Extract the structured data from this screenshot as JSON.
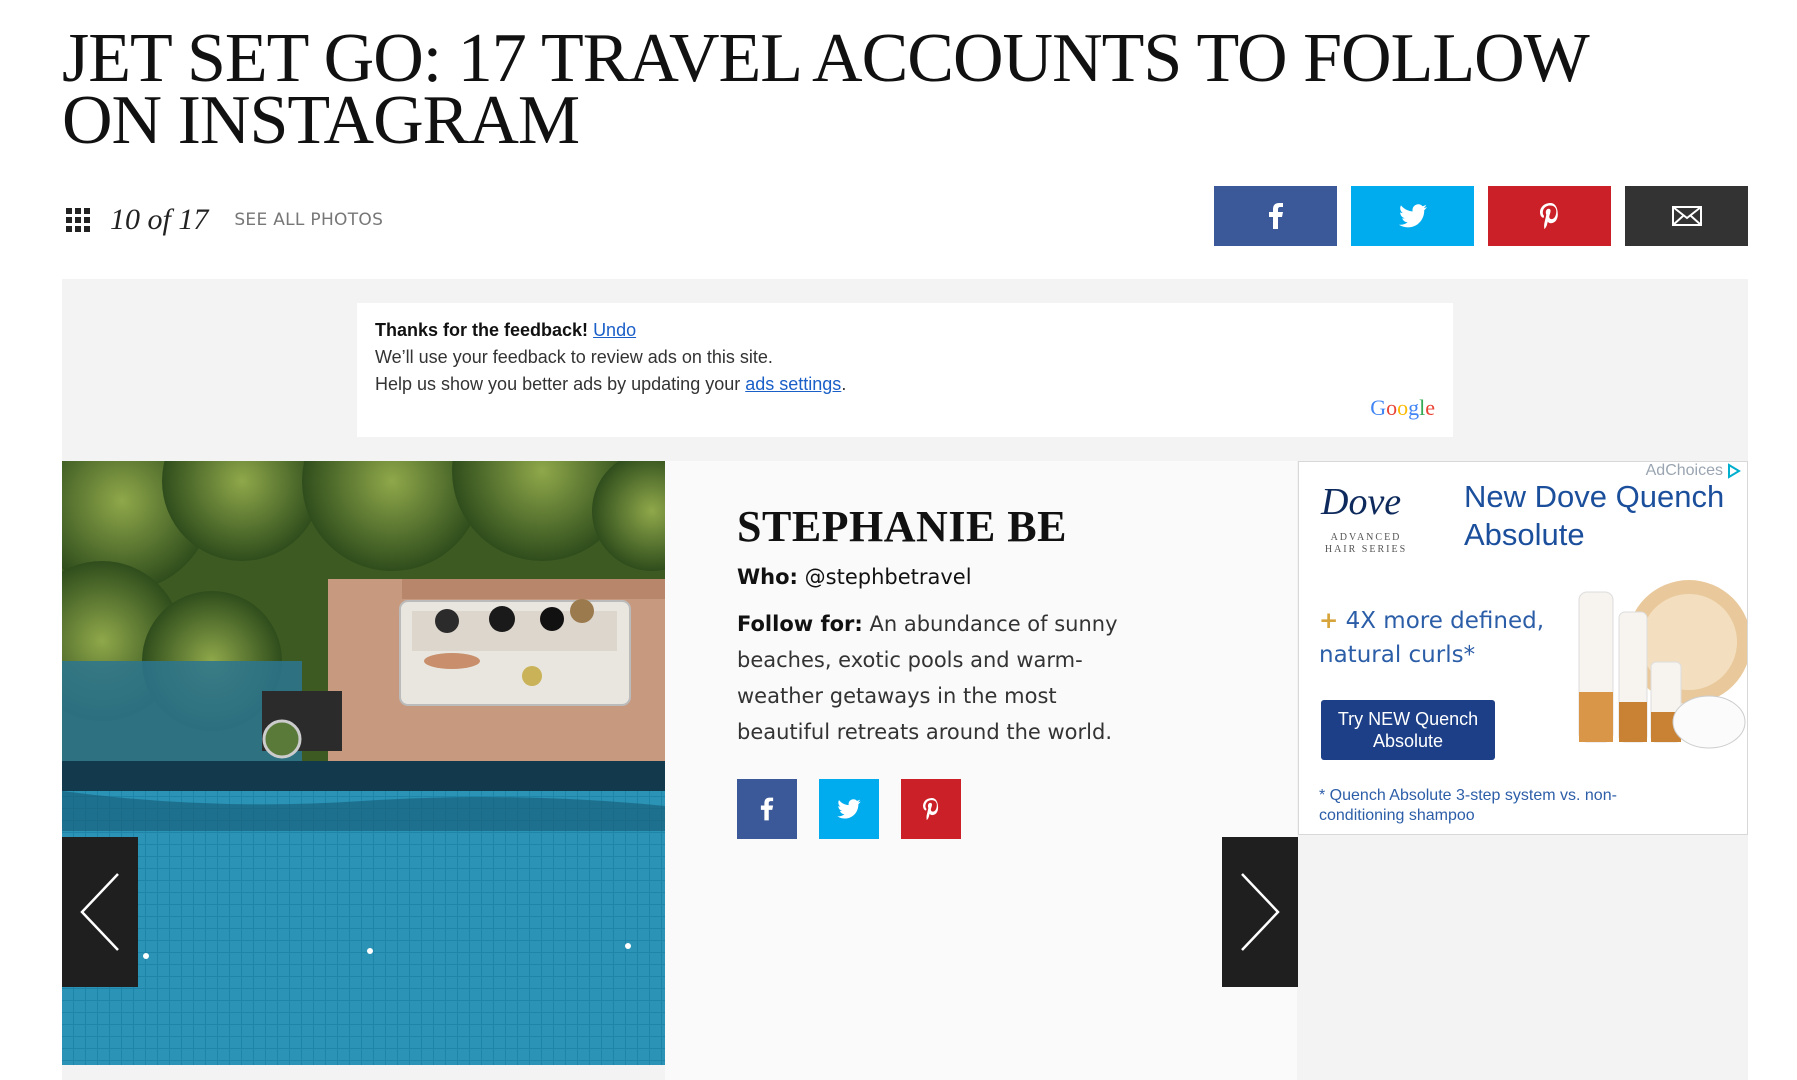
{
  "title": "JET SET GO: 17 TRAVEL ACCOUNTS TO FOLLOW ON INSTAGRAM",
  "gallery": {
    "counter": "10 of 17",
    "see_all": "SEE ALL PHOTOS"
  },
  "share": {
    "facebook_color": "#3b5998",
    "twitter_color": "#00aced",
    "pinterest_color": "#cb2027",
    "email_color": "#333333"
  },
  "feedback": {
    "thanks": "Thanks for the feedback!",
    "undo": "Undo",
    "line2": "We’ll use your feedback to review ads on this site.",
    "line3_prefix": "Help us show you better ads by updating your",
    "ads_settings": "ads settings",
    "line3_suffix": ".",
    "google": "Google"
  },
  "slide": {
    "name": "STEPHANIE BE",
    "who_label": "Who:",
    "who_value": "@stephbetravel",
    "follow_label": "Follow for:",
    "follow_value": "An abundance of sunny beaches, exotic pools and warm-weather getaways in the most beautiful retreats around the world."
  },
  "ad": {
    "adchoices": "AdChoices",
    "brand": "Dove",
    "brand_sub": "ADVANCED HAIR SERIES",
    "headline": "New Dove Quench Absolute",
    "claim_plus": "+",
    "claim": "4X more defined, natural curls*",
    "cta": "Try NEW Quench Absolute",
    "footnote": "* Quench Absolute 3-step system vs. non-conditioning shampoo"
  }
}
